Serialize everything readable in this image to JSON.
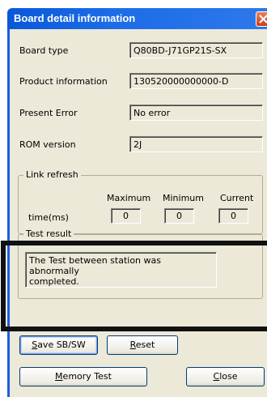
{
  "window": {
    "title": "Board detail information"
  },
  "fields": [
    {
      "label": "Board type",
      "value": "Q80BD-J71GP21S-SX"
    },
    {
      "label": "Product information",
      "value": "130520000000000-D"
    },
    {
      "label": "Present Error",
      "value": "No error"
    },
    {
      "label": "ROM version",
      "value": "2J"
    }
  ],
  "link_refresh": {
    "title": "Link refresh",
    "row_label": "time(ms)",
    "columns": [
      "Maximum",
      "Minimum",
      "Current"
    ],
    "values": [
      "0",
      "0",
      "0"
    ]
  },
  "test_result": {
    "title": "Test result",
    "line1": "The Test between station was abnormally",
    "line2": "completed."
  },
  "buttons": {
    "save_prefix": "S",
    "save_rest": "ave SB/SW",
    "reset_prefix": "R",
    "reset_rest": "eset",
    "memory_pre": "",
    "memory_ul": "M",
    "memory_rest": "emory Test",
    "close_prefix": "C",
    "close_rest": "lose"
  },
  "icons": {
    "close": "close-x-icon"
  }
}
